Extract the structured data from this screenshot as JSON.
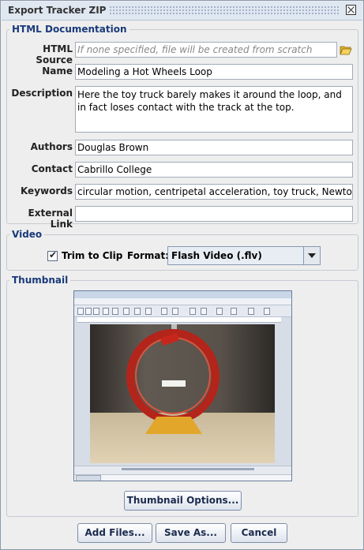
{
  "window": {
    "title": "Export Tracker ZIP"
  },
  "html_doc": {
    "legend": "HTML Documentation",
    "html_source": {
      "label": "HTML Source",
      "placeholder": "If none specified, file will be created from scratch",
      "value": ""
    },
    "name": {
      "label": "Name",
      "value": "Modeling a Hot Wheels Loop"
    },
    "description": {
      "label": "Description",
      "value": "Here the toy truck barely makes it around the loop, and in fact loses contact with the track at the top."
    },
    "authors": {
      "label": "Authors",
      "value": "Douglas Brown"
    },
    "contact": {
      "label": "Contact",
      "value": "Cabrillo College"
    },
    "keywords": {
      "label": "Keywords",
      "value": "circular motion, centripetal acceleration, toy truck, Newton's seco"
    },
    "external_link": {
      "label": "External Link",
      "value": ""
    }
  },
  "video": {
    "legend": "Video",
    "trim_to_clip": {
      "label": "Trim to Clip",
      "checked": true
    },
    "format": {
      "label": "Format:",
      "selected": "Flash Video (.flv)"
    }
  },
  "thumbnail": {
    "legend": "Thumbnail",
    "options_button": "Thumbnail Options..."
  },
  "footer": {
    "add_files": "Add Files...",
    "save_as": "Save As...",
    "cancel": "Cancel"
  },
  "icons": {
    "close": "close-icon",
    "open_folder": "folder-open-icon",
    "checkmark": "checkmark-icon",
    "dropdown_arrow": "chevron-down-icon"
  }
}
